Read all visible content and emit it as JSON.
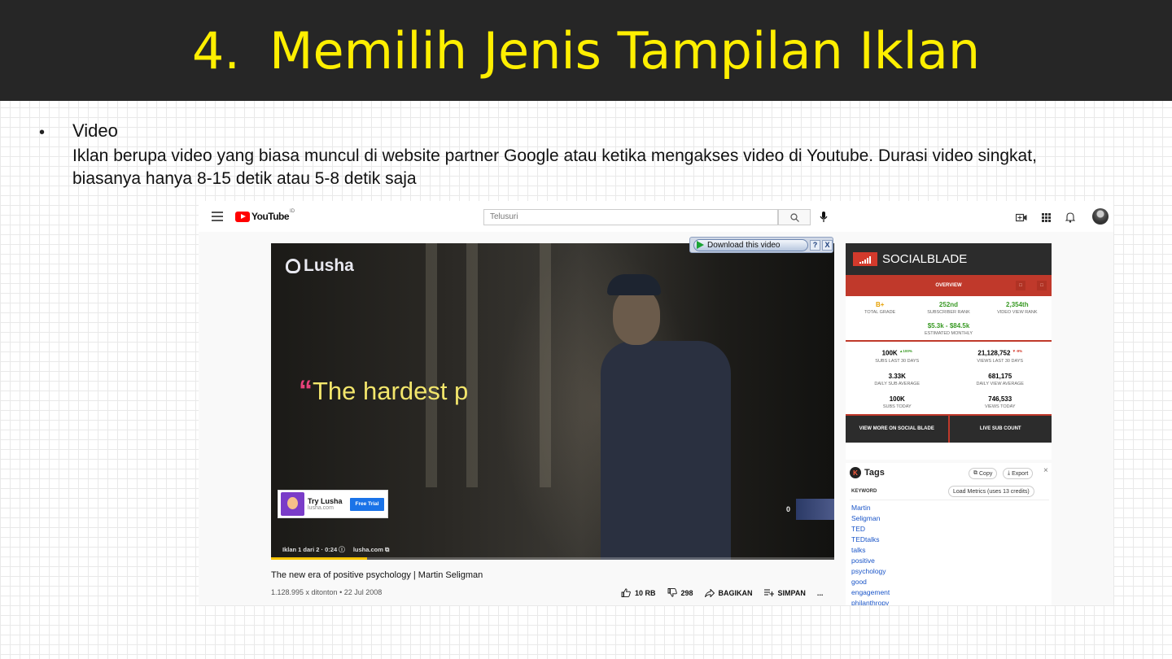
{
  "slide": {
    "number": "4.",
    "title": "Memilih Jenis Tampilan Iklan",
    "bullet": "•",
    "heading": "Video",
    "body": "Iklan berupa video yang biasa muncul di website partner Google atau ketika mengakses video di Youtube. Durasi video singkat, biasanya hanya 8-15 detik atau 5-8 detik saja"
  },
  "youtube": {
    "logo_text": "YouTube",
    "region": "ID",
    "search_placeholder": "Telusuri",
    "ad": {
      "brand": "Lusha",
      "quote": "The hardest p",
      "card_title": "Try Lusha",
      "card_url": "lusha.com",
      "card_button": "Free Trial",
      "ad_info": "Iklan 1 dari 2 · 0:24",
      "ad_url": "lusha.com",
      "skip_count": "0",
      "progress": 0.17
    },
    "download_bar": {
      "label": "Download this video",
      "help": "?",
      "close": "X"
    },
    "video_title": "The new era of positive psychology | Martin Seligman",
    "video_meta": "1.128.995 x ditonton • 22 Jul 2008",
    "actions": {
      "like": "10 RB",
      "dislike": "298",
      "share": "BAGIKAN",
      "save": "SIMPAN",
      "more": "..."
    }
  },
  "socialblade": {
    "name": "SOCIALBLADE",
    "nav": "OVERVIEW",
    "nav_sq": "□",
    "grade": "B+",
    "grade_label": "TOTAL GRADE",
    "sub_rank": "252nd",
    "sub_rank_label": "SUBSCRIBER RANK",
    "view_rank": "2,354th",
    "view_rank_label": "VIDEO VIEW RANK",
    "monthly": "$5.3k - $84.5k",
    "monthly_label": "ESTIMATED MONTHLY",
    "subs_30": "100K",
    "subs_30_change": "▲100%",
    "subs_30_label": "SUBS LAST 30 DAYS",
    "views_30": "21,128,752",
    "views_30_change": "▼-9%",
    "views_30_label": "VIEWS LAST 30 DAYS",
    "daily_sub": "3.33K",
    "daily_sub_label": "DAILY SUB AVERAGE",
    "daily_view": "681,175",
    "daily_view_label": "DAILY VIEW AVERAGE",
    "subs_today": "100K",
    "subs_today_label": "SUBS TODAY",
    "views_today": "746,533",
    "views_today_label": "VIEWS TODAY",
    "more_btn": "VIEW MORE ON SOCIAL BLADE",
    "live_btn": "LIVE SUB COUNT"
  },
  "tags": {
    "logo": "K",
    "title": "Tags",
    "copy": "Copy",
    "export": "Export",
    "close": "×",
    "keyword_label": "KEYWORD",
    "load_metrics": "Load Metrics (uses 13 credits)",
    "keywords": [
      "Martin",
      "Seligman",
      "TED",
      "TEDtalks",
      "talks",
      "positive",
      "psychology",
      "good",
      "engagement",
      "philanthropy"
    ]
  }
}
